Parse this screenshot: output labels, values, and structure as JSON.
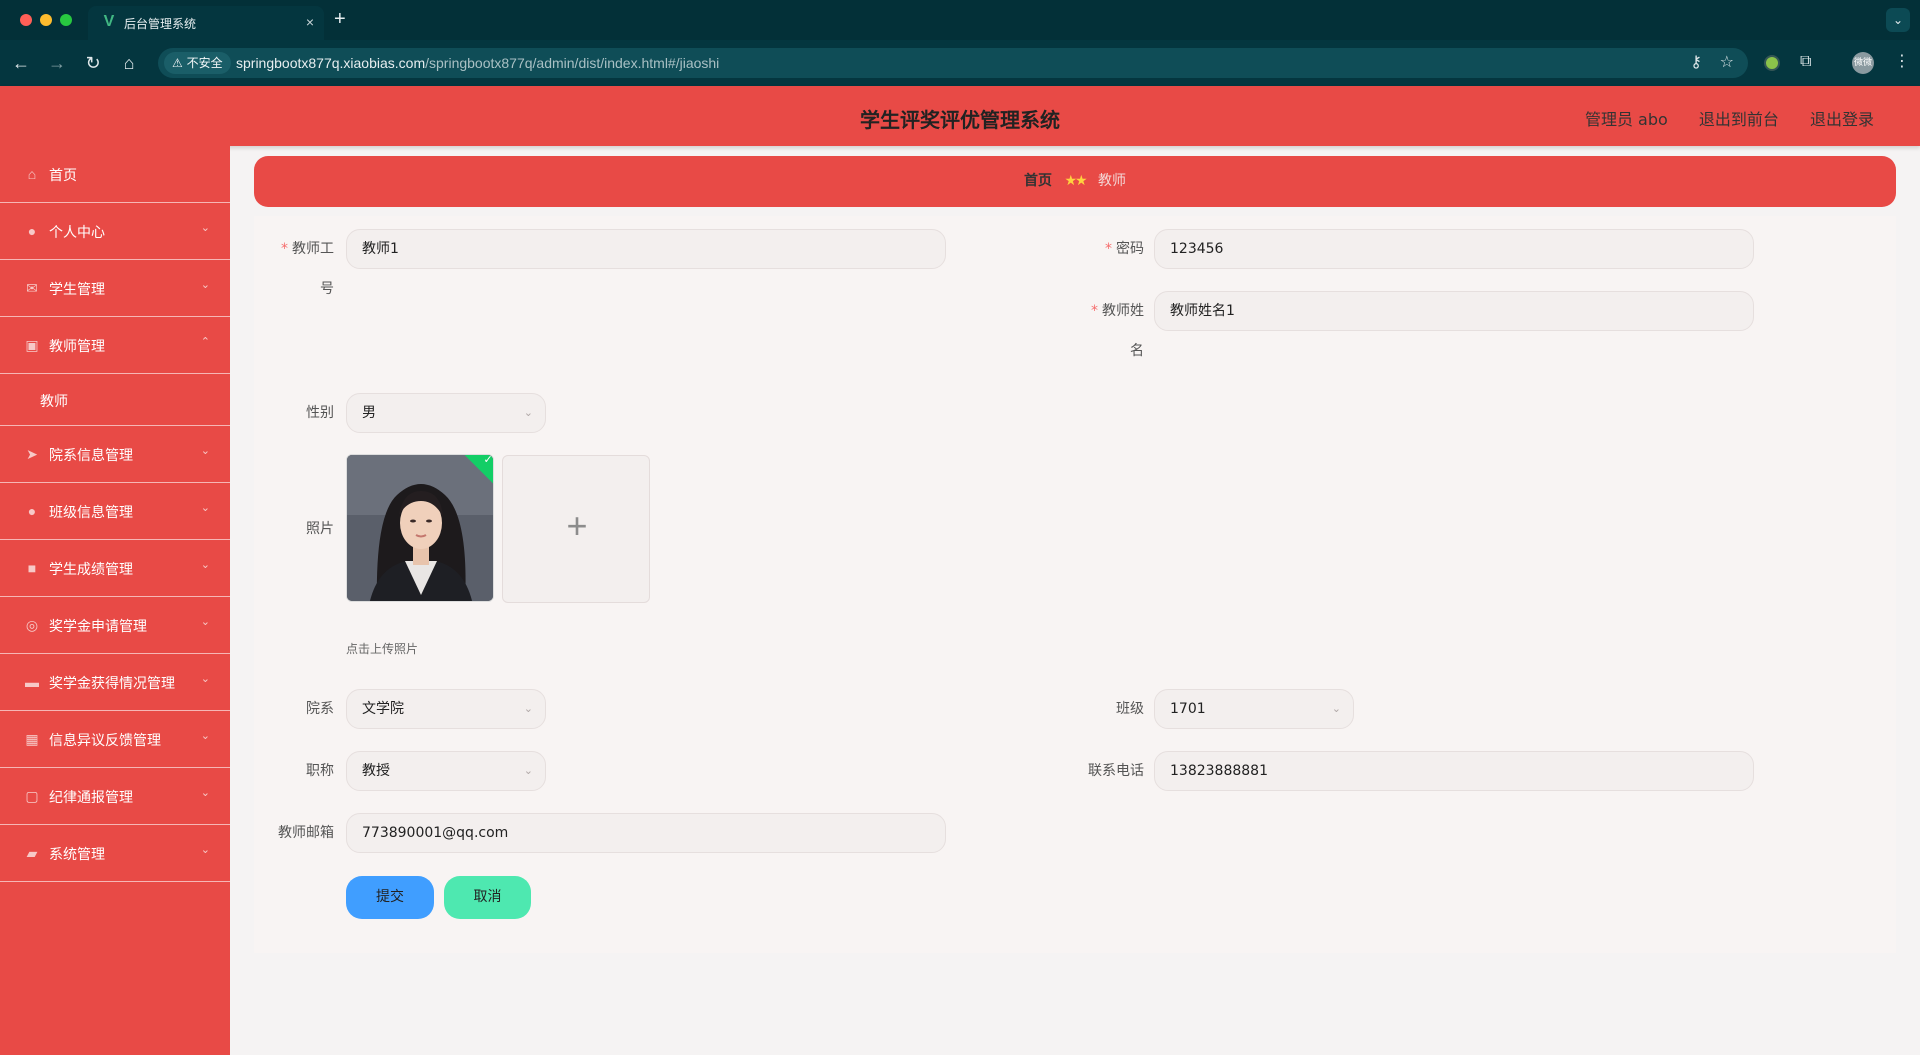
{
  "browser": {
    "tab_title": "后台管理系统",
    "tab_favicon": "V",
    "new_tab": "+",
    "tab_close": "×",
    "insecure_label": "不安全",
    "url_host": "springbootx877q.xiaobias.com",
    "url_path": "/springbootx877q/admin/dist/index.html#/jiaoshi",
    "profile_label": "微微"
  },
  "header": {
    "title": "学生评奖评优管理系统",
    "admin_label": "管理员 abo",
    "to_frontend": "退出到前台",
    "logout": "退出登录"
  },
  "sidebar": {
    "items": [
      {
        "label": "首页",
        "icon": "home-icon"
      },
      {
        "label": "个人中心",
        "icon": "user-icon"
      },
      {
        "label": "学生管理",
        "icon": "mail-icon"
      },
      {
        "label": "教师管理",
        "icon": "edit-icon",
        "expanded": true
      },
      {
        "label": "院系信息管理",
        "icon": "send-icon"
      },
      {
        "label": "班级信息管理",
        "icon": "person-icon"
      },
      {
        "label": "学生成绩管理",
        "icon": "briefcase-icon"
      },
      {
        "label": "奖学金申请管理",
        "icon": "compass-icon"
      },
      {
        "label": "奖学金获得情况管理",
        "icon": "monitor-icon"
      },
      {
        "label": "信息异议反馈管理",
        "icon": "grid-icon"
      },
      {
        "label": "纪律通报管理",
        "icon": "crop-icon"
      },
      {
        "label": "系统管理",
        "icon": "chat-icon"
      }
    ],
    "sub_item": "教师"
  },
  "breadcrumb": {
    "home": "首页",
    "separator": "★★",
    "current": "教师"
  },
  "form": {
    "teacher_id_label_1": "教师工",
    "teacher_id_label_2": "号",
    "teacher_id_value": "教师1",
    "password_label": "密码",
    "password_value": "123456",
    "teacher_name_label_1": "教师姓",
    "teacher_name_label_2": "名",
    "teacher_name_value": "教师姓名1",
    "gender_label": "性别",
    "gender_value": "男",
    "photo_label": "照片",
    "upload_tip": "点击上传照片",
    "upload_plus": "+",
    "department_label": "院系",
    "department_value": "文学院",
    "class_label": "班级",
    "class_value": "1701",
    "title_label": "职称",
    "title_value": "教授",
    "phone_label": "联系电话",
    "phone_value": "13823888881",
    "email_label": "教师邮箱",
    "email_value": "773890001@qq.com",
    "required_mark": "*",
    "submit": "提交",
    "cancel": "取消"
  },
  "colors": {
    "primary_red": "#e84a46",
    "submit_blue": "#409eff",
    "cancel_green": "#4ee8b0",
    "required_red": "#f56c6c"
  }
}
